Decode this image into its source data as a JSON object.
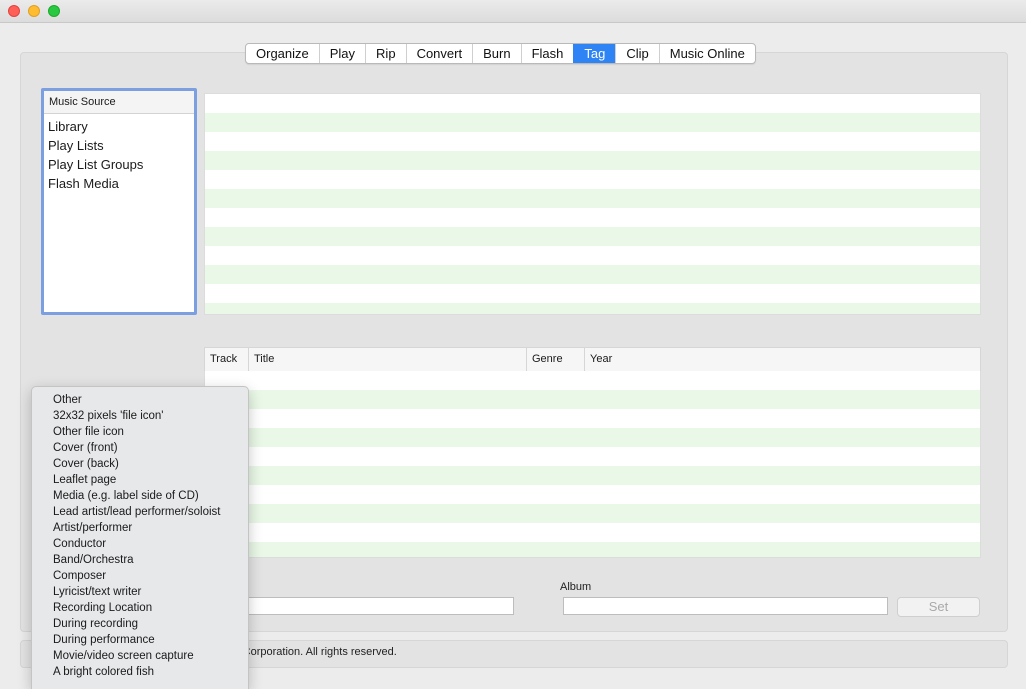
{
  "tabs": [
    {
      "label": "Organize",
      "active": false
    },
    {
      "label": "Play",
      "active": false
    },
    {
      "label": "Rip",
      "active": false
    },
    {
      "label": "Convert",
      "active": false
    },
    {
      "label": "Burn",
      "active": false
    },
    {
      "label": "Flash",
      "active": false
    },
    {
      "label": "Tag",
      "active": true
    },
    {
      "label": "Clip",
      "active": false
    },
    {
      "label": "Music Online",
      "active": false
    }
  ],
  "source": {
    "header": "Music Source",
    "items": [
      "Library",
      "Play Lists",
      "Play List Groups",
      "Flash Media"
    ]
  },
  "track_table": {
    "columns": [
      "Track",
      "Title",
      "Genre",
      "Year"
    ]
  },
  "form": {
    "album_label": "Album",
    "artist_value": "",
    "album_value": "",
    "set_label": "Set"
  },
  "footer": {
    "text": "gy Corporation. All rights reserved."
  },
  "dropdown": {
    "items": [
      "Other",
      "32x32 pixels 'file icon'",
      "Other file icon",
      "Cover (front)",
      "Cover (back)",
      "Leaflet page",
      "Media (e.g. label side of CD)",
      "Lead artist/lead performer/soloist",
      "Artist/performer",
      "Conductor",
      "Band/Orchestra",
      "Composer",
      "Lyricist/text writer",
      "Recording Location",
      "During recording",
      "During performance",
      "Movie/video screen capture",
      "A bright colored fish"
    ]
  },
  "colors": {
    "accent": "#2f84f5",
    "row_stripe": "#e9f8e7",
    "source_focus": "#7b9fe0"
  }
}
